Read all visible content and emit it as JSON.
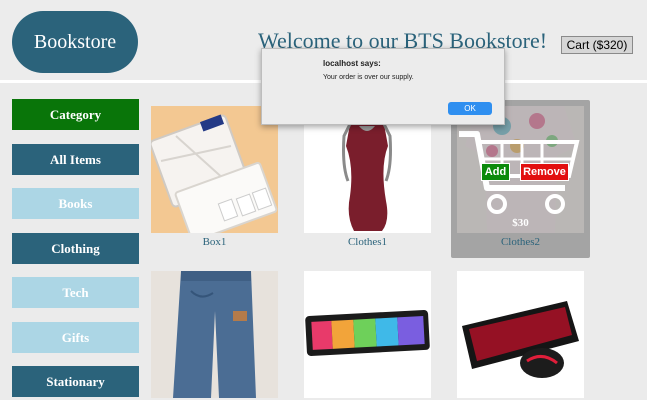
{
  "header": {
    "logo": "Bookstore",
    "welcome": "Welcome to our BTS Bookstore!",
    "cart": "Cart ($320)"
  },
  "sidebar": {
    "items": [
      {
        "label": "Category"
      },
      {
        "label": "All Items"
      },
      {
        "label": "Books"
      },
      {
        "label": "Clothing"
      },
      {
        "label": "Tech"
      },
      {
        "label": "Gifts"
      },
      {
        "label": "Stationary"
      }
    ]
  },
  "products": [
    {
      "name": "Box1"
    },
    {
      "name": "Clothes1"
    },
    {
      "name": "Clothes2",
      "price": "$30",
      "add": "Add",
      "remove": "Remove"
    }
  ],
  "dialog": {
    "title": "localhost says:",
    "message": "Your order is over our supply.",
    "ok": "OK"
  },
  "colors": {
    "primary": "#2b637b",
    "category_green": "#097509",
    "light_blue": "#acd6e5",
    "add_green": "#0b8a0b",
    "remove_red": "#e20f0f",
    "ok_blue": "#2f8ff0"
  }
}
